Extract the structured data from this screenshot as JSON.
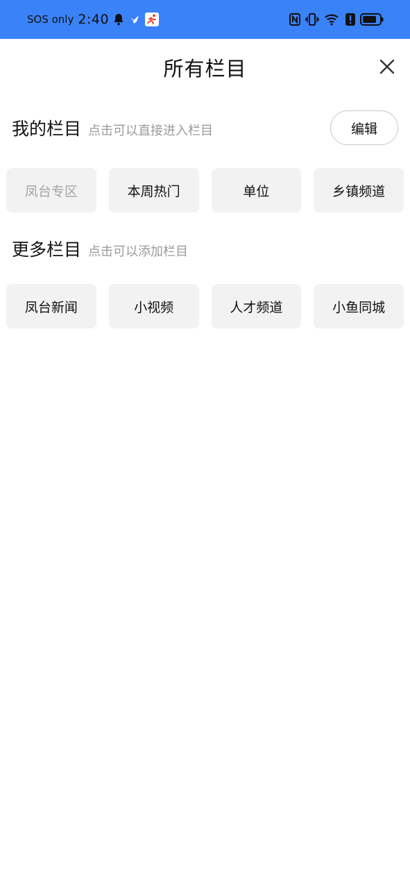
{
  "status_bar": {
    "sos": "SOS only",
    "time": "2:40",
    "left_icons": [
      "bell-icon",
      "bird-app-icon",
      "runner-app-icon"
    ],
    "right_icons": [
      "nfc-icon",
      "vibrate-icon",
      "wifi-icon",
      "alert-icon",
      "battery-icon"
    ],
    "background": "#3a82f7"
  },
  "header": {
    "title": "所有栏目"
  },
  "my_channels": {
    "title": "我的栏目",
    "hint": "点击可以直接进入栏目",
    "edit_label": "编辑",
    "items": [
      {
        "label": "凤台专区",
        "fixed": true
      },
      {
        "label": "本周热门",
        "fixed": false
      },
      {
        "label": "单位",
        "fixed": false
      },
      {
        "label": "乡镇频道",
        "fixed": false
      }
    ]
  },
  "more_channels": {
    "title": "更多栏目",
    "hint": "点击可以添加栏目",
    "items": [
      {
        "label": "凤台新闻"
      },
      {
        "label": "小视频"
      },
      {
        "label": "人才频道"
      },
      {
        "label": "小鱼同城"
      }
    ]
  }
}
